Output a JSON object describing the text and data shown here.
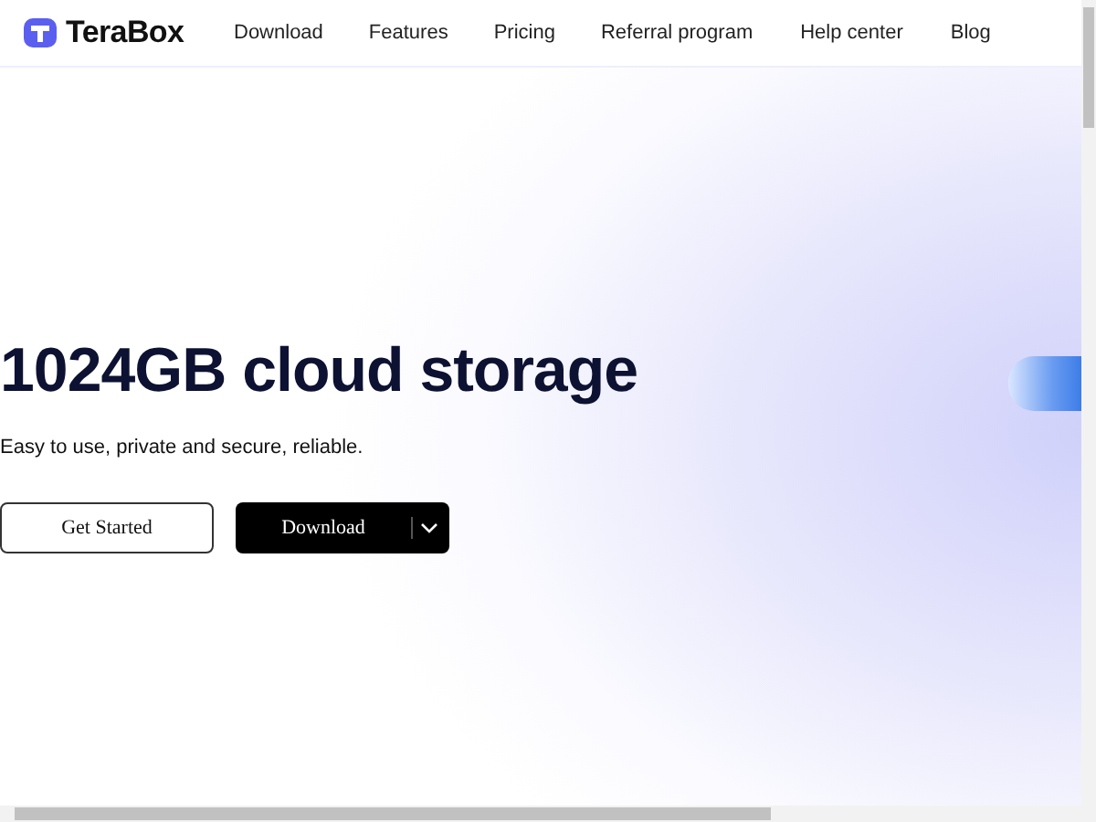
{
  "header": {
    "brand": "TeraBox",
    "nav": [
      "Download",
      "Features",
      "Pricing",
      "Referral program",
      "Help center",
      "Blog"
    ]
  },
  "hero": {
    "title": "1024GB cloud storage",
    "subtitle": "Easy to use, private and secure, reliable.",
    "buttons": [
      {
        "label": "Get Started",
        "kind": "outline"
      },
      {
        "label": "Download",
        "kind": "dropdown"
      }
    ]
  }
}
